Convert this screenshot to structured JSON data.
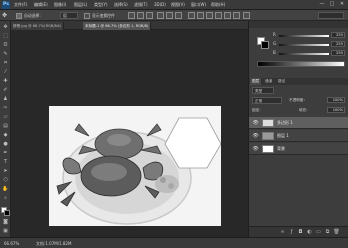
{
  "menubar": {
    "app_logo": "Ps",
    "items": [
      "文件(F)",
      "编辑(E)",
      "图像(I)",
      "图层(L)",
      "类型(Y)",
      "选择(S)",
      "滤镜(T)",
      "3D(D)",
      "视图(V)",
      "窗口(W)",
      "帮助(H)"
    ],
    "window_buttons": [
      "—",
      "□",
      "✕"
    ]
  },
  "optionsbar": {
    "auto_select_label": "自动选择：",
    "auto_select_value": "组",
    "show_transform_label": "显示变换控件"
  },
  "tabs": [
    {
      "label": "螃蟹.jpg @ 66.7%(RGB/8#)",
      "active": false
    },
    {
      "label": "未标题-1 @ 66.7% (多边形 1, RGB/8)",
      "active": true
    }
  ],
  "canvas": {
    "photo_alt": "plate of crabs",
    "hexagon_color": "#ffffff"
  },
  "statusbar": {
    "zoom": "66.67%",
    "doc_info": "文档:1.07M/1.82M"
  },
  "color_panel": {
    "sliders": [
      {
        "label": "R",
        "value": "255"
      },
      {
        "label": "G",
        "value": "255"
      },
      {
        "label": "B",
        "value": "255"
      }
    ]
  },
  "layers_panel": {
    "tabs": [
      "图层",
      "通道",
      "路径"
    ],
    "filter_label": "类型",
    "blend_mode": "正常",
    "opacity_label": "不透明度：",
    "opacity_value": "100%",
    "lock_label": "锁定：",
    "fill_label": "填充：",
    "fill_value": "100%",
    "layers": [
      {
        "name": "多边形 1",
        "selected": true
      },
      {
        "name": "图层 1",
        "selected": false
      },
      {
        "name": "背景",
        "selected": false
      }
    ],
    "footer_icons": [
      "link-icon",
      "fx-icon",
      "mask-icon",
      "adjustment-icon",
      "group-icon",
      "new-layer-icon",
      "trash-icon"
    ]
  },
  "colors": {
    "ui_dark": "#2b2b2b",
    "panel": "#3d3d3d",
    "selected_layer": "#5f5f5f"
  }
}
